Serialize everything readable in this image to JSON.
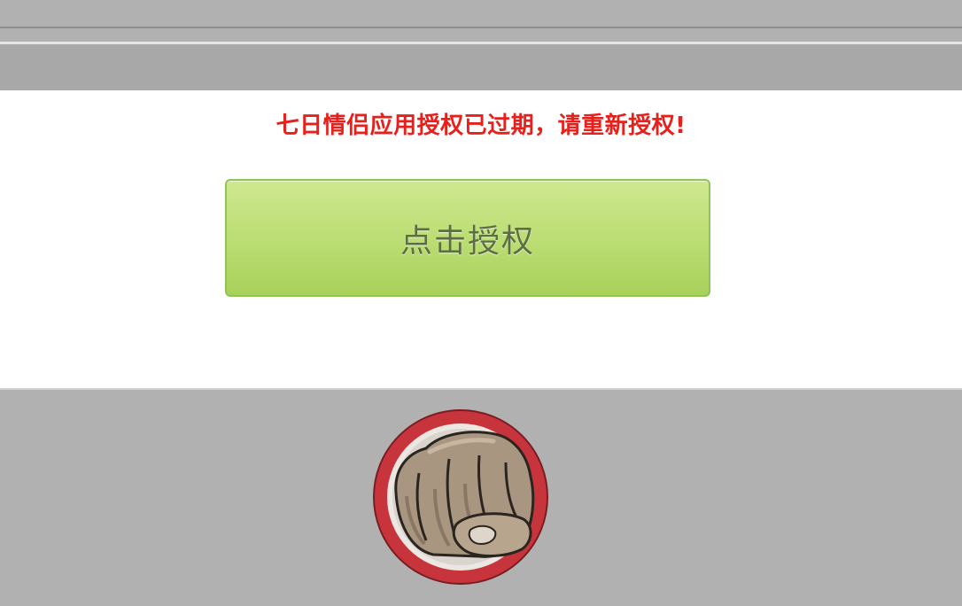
{
  "notice": {
    "text": "七日情侣应用授权已过期，请重新授权!",
    "color": "#e8201c"
  },
  "auth_button": {
    "label": "点击授权",
    "color": "#bedf77"
  },
  "badge": {
    "icon": "fist-icon",
    "ring_color": "#c8343c"
  }
}
